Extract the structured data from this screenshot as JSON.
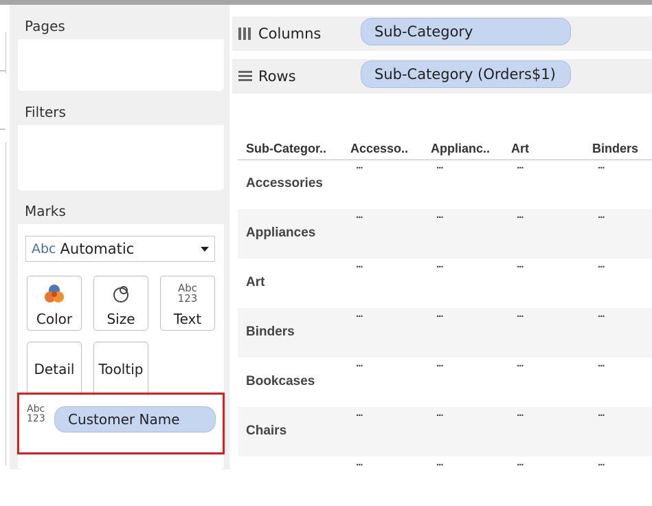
{
  "left_pane": {
    "pages": {
      "title": "Pages"
    },
    "filters": {
      "title": "Filters"
    },
    "marks": {
      "title": "Marks",
      "mark_type": {
        "abc": "Abc",
        "value": "Automatic"
      },
      "buttons": {
        "color": "Color",
        "size": "Size",
        "text": "Text",
        "text_glyph_top": "Abc",
        "text_glyph_bottom": "123",
        "detail": "Detail",
        "tooltip": "Tooltip"
      },
      "text_field": {
        "glyph_top": "Abc",
        "glyph_bottom": "123",
        "pill": "Customer Name"
      }
    }
  },
  "shelves": {
    "columns": {
      "label": "Columns",
      "pill": "Sub-Category"
    },
    "rows": {
      "label": "Rows",
      "pill": "Sub-Category (Orders$1)"
    }
  },
  "table": {
    "headers": [
      "Sub-Categor..",
      "Accesso..",
      "Applianc..",
      "Art",
      "Binders"
    ],
    "cell_placeholder": "...",
    "rows": [
      "Accessories",
      "Appliances",
      "Art",
      "Binders",
      "Bookcases",
      "Chairs",
      ""
    ]
  },
  "colors": {
    "pill_fill": "#c6d6f0",
    "highlight_border": "#e01b1b",
    "pane_background": "#f0f0f0"
  }
}
